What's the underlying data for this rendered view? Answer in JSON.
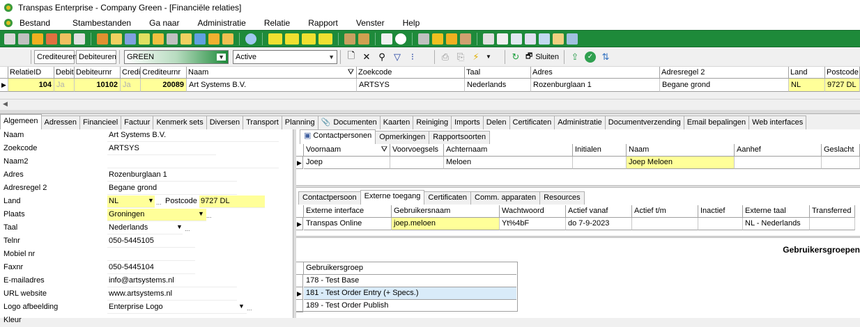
{
  "window": {
    "title": "Transpas Enterprise - Company Green - [Financiële relaties]"
  },
  "menu": [
    "Bestand",
    "Stambestanden",
    "Ga naar",
    "Administratie",
    "Relatie",
    "Rapport",
    "Venster",
    "Help"
  ],
  "toolbar2": {
    "crediteuren_label": "Crediteuren",
    "debiteuren_label": "Debiteuren",
    "company_value": "GREEN",
    "status_value": "Active",
    "sluiten_label": "Sluiten"
  },
  "top_grid": {
    "headers": [
      "RelatieID",
      "Debit",
      "Debiteurnr",
      "Credi",
      "Crediteurnr",
      "Naam",
      "Zoekcode",
      "Taal",
      "Adres",
      "Adresregel 2",
      "Land",
      "Postcode"
    ],
    "row": [
      "104",
      "Ja",
      "10102",
      "Ja",
      "20089",
      "Art Systems B.V.",
      "ARTSYS",
      "Nederlands",
      "Rozenburglaan 1",
      "Begane grond",
      "NL",
      "9727 DL"
    ]
  },
  "tabs": [
    "Algemeen",
    "Adressen",
    "Financieel",
    "Factuur",
    "Kenmerk sets",
    "Diversen",
    "Transport",
    "Planning",
    "Documenten",
    "Kaarten",
    "Reiniging",
    "Imports",
    "Delen",
    "Certificaten",
    "Administratie",
    "Documentverzending",
    "Email bepalingen",
    "Web interfaces"
  ],
  "form": {
    "naam": {
      "label": "Naam",
      "value": "Art Systems B.V."
    },
    "zoekcode": {
      "label": "Zoekcode",
      "value": "ARTSYS"
    },
    "naam2": {
      "label": "Naam2",
      "value": ""
    },
    "adres": {
      "label": "Adres",
      "value": "Rozenburglaan 1"
    },
    "adresregel2": {
      "label": "Adresregel 2",
      "value": "Begane grond"
    },
    "land": {
      "label": "Land",
      "value": "NL"
    },
    "postcode": {
      "label": "Postcode",
      "value": "9727 DL"
    },
    "plaats": {
      "label": "Plaats",
      "value": "Groningen"
    },
    "taal": {
      "label": "Taal",
      "value": "Nederlands"
    },
    "telnr": {
      "label": "Telnr",
      "value": "050-5445105"
    },
    "mobiel": {
      "label": "Mobiel nr",
      "value": ""
    },
    "faxnr": {
      "label": "Faxnr",
      "value": "050-5445104"
    },
    "email": {
      "label": "E-mailadres",
      "value": "info@artsystems.nl"
    },
    "url": {
      "label": "URL website",
      "value": "www.artsystems.nl"
    },
    "logo": {
      "label": "Logo afbeelding",
      "value": "Enterprise Logo"
    },
    "kleur": {
      "label": "Kleur",
      "value": ""
    }
  },
  "contact_tabs": [
    "Contactpersonen",
    "Opmerkingen",
    "Rapportsoorten"
  ],
  "contact_grid": {
    "headers": [
      "Voornaam",
      "Voorvoegsels",
      "Achternaam",
      "Initialen",
      "Naam",
      "Aanhef",
      "Geslacht"
    ],
    "row": [
      "Joep",
      "",
      "Meloen",
      "",
      "Joep Meloen",
      "",
      ""
    ]
  },
  "detail_tabs": [
    "Contactpersoon",
    "Externe toegang",
    "Certificaten",
    "Comm. apparaten",
    "Resources"
  ],
  "ext_grid": {
    "headers": [
      "Externe interface",
      "Gebruikersnaam",
      "Wachtwoord",
      "Actief vanaf",
      "Actief t/m",
      "Inactief",
      "Externe taal",
      "Transferred"
    ],
    "row": [
      "Transpas Online",
      "joep.meloen",
      "Yt%4bF",
      "do 7-9-2023",
      "",
      "",
      "NL - Nederlands",
      ""
    ]
  },
  "groups": {
    "title": "Gebruikersgroepen",
    "header": "Gebruikersgroep",
    "rows": [
      "178 - Test Base",
      "181 - Test Order Entry (+ Specs.)",
      "189 - Test Order Publish"
    ]
  },
  "colors": {
    "accent_green": "#1e8a3a",
    "highlight_yellow": "#ffff99",
    "selection": "#d9ebf9"
  }
}
